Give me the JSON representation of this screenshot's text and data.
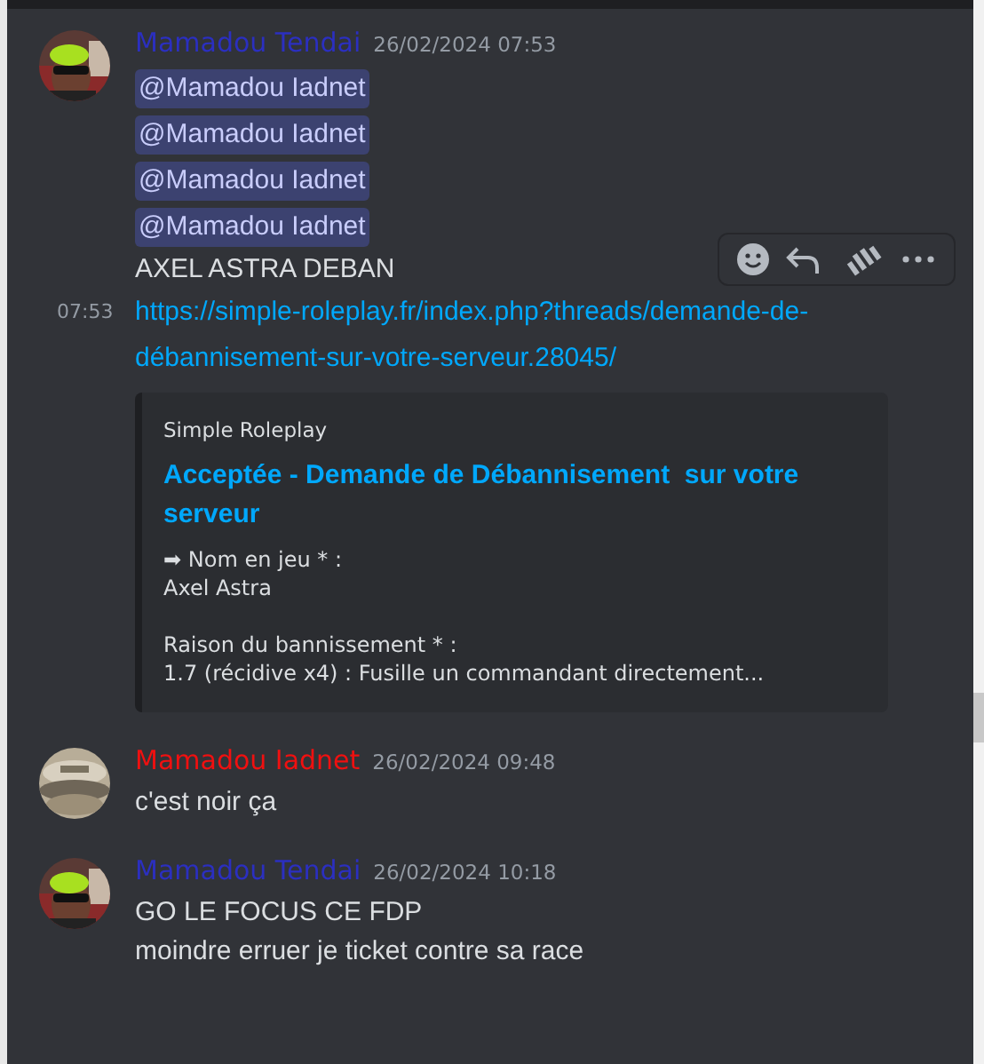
{
  "messages": [
    {
      "author": "Mamadou Tendai",
      "color": "#2b2fc0",
      "timestamp": "26/02/2024 07:53",
      "avatar": {
        "kind": "picture"
      },
      "lines": [
        {
          "kind": "mention",
          "text": "@Mamadou Iadnet"
        },
        {
          "kind": "mention",
          "text": "@Mamadou Iadnet"
        },
        {
          "kind": "mention",
          "text": "@Mamadou Iadnet"
        },
        {
          "kind": "mention",
          "text": "@Mamadou Iadnet"
        },
        {
          "kind": "text",
          "text": "AXEL ASTRA DEBAN",
          "hovered": true
        },
        {
          "kind": "link",
          "time": "07:53",
          "text": "https://simple-roleplay.fr/index.php?threads/demande-de-débannisement-sur-votre-serveur.28045/"
        },
        {
          "kind": "embed",
          "provider": "Simple Roleplay",
          "title": "Acceptée - Demande de Débannisement  sur votre serveur",
          "fields": [
            {
              "label": "➡ Nom en jeu * :",
              "value": "Axel Astra"
            },
            {
              "label": "Raison du bannissement * :",
              "value": "1.7 (récidive x4) : Fusille un commandant directement..."
            }
          ]
        }
      ]
    },
    {
      "author": "Mamadou Iadnet",
      "color": "#f01010",
      "timestamp": "26/02/2024 09:48",
      "avatar": {
        "kind": "picture"
      },
      "lines": [
        {
          "kind": "text",
          "text": "c'est noir ça"
        }
      ]
    },
    {
      "author": "Mamadou Tendai",
      "color": "#2b2fc0",
      "timestamp": "26/02/2024 10:18",
      "avatar": {
        "kind": "picture"
      },
      "lines": [
        {
          "kind": "text",
          "text": "GO LE FOCUS CE FDP"
        },
        {
          "kind": "text",
          "text": "moindre erruer je ticket contre sa race"
        }
      ]
    }
  ]
}
